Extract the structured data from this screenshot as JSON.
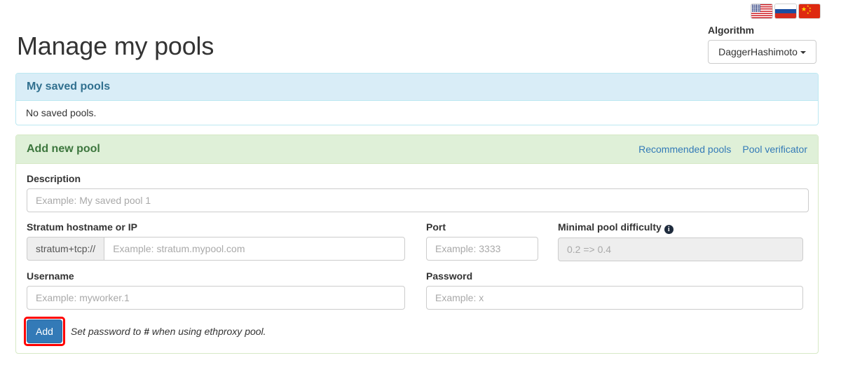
{
  "languages": [
    {
      "name": "flag-us-icon",
      "label": "English"
    },
    {
      "name": "flag-ru-icon",
      "label": "Russian"
    },
    {
      "name": "flag-cn-icon",
      "label": "Chinese"
    }
  ],
  "algorithm": {
    "label": "Algorithm",
    "selected": "DaggerHashimoto"
  },
  "page_title": "Manage my pools",
  "saved_pools_panel": {
    "title": "My saved pools",
    "empty_text": "No saved pools."
  },
  "add_pool_panel": {
    "title": "Add new pool",
    "links": [
      {
        "label": "Recommended pools"
      },
      {
        "label": "Pool verificator"
      }
    ],
    "fields": {
      "description": {
        "label": "Description",
        "placeholder": "Example: My saved pool 1",
        "value": ""
      },
      "stratum_host": {
        "label": "Stratum hostname or IP",
        "addon": "stratum+tcp://",
        "placeholder": "Example: stratum.mypool.com",
        "value": ""
      },
      "port": {
        "label": "Port",
        "placeholder": "Example: 3333",
        "value": ""
      },
      "difficulty": {
        "label": "Minimal pool difficulty",
        "info_icon": "info-icon",
        "placeholder": "0.2 => 0.4",
        "value": ""
      },
      "username": {
        "label": "Username",
        "placeholder": "Example: myworker.1",
        "value": ""
      },
      "password": {
        "label": "Password",
        "placeholder": "Example: x",
        "value": ""
      }
    },
    "add_button": "Add",
    "hint_prefix": "Set password to ",
    "hint_bold": "#",
    "hint_suffix": " when using ethproxy pool."
  },
  "colors": {
    "primary": "#337ab7",
    "info_panel_bg": "#d9edf7",
    "info_panel_border": "#bce8f1",
    "info_panel_text": "#31708f",
    "success_panel_bg": "#dff0d8",
    "success_panel_border": "#d6e9c6",
    "success_panel_text": "#3c763d",
    "highlight": "#ff0000"
  }
}
